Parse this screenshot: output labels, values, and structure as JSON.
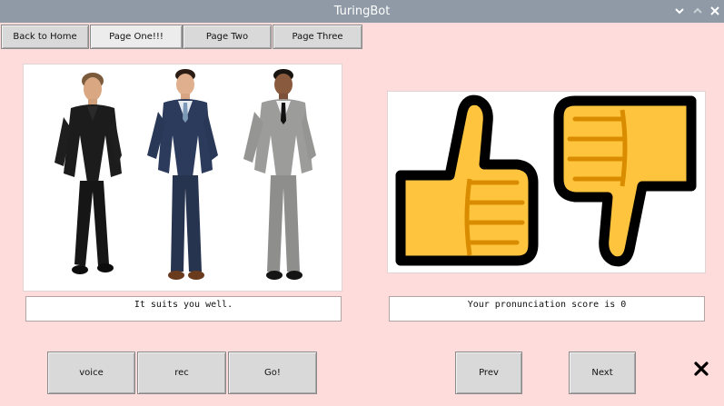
{
  "window": {
    "title": "TuringBot"
  },
  "nav": {
    "back_home": "Back to Home",
    "page_one": "Page One!!!",
    "page_two": "Page Two",
    "page_three": "Page Three"
  },
  "left_panel": {
    "image": "suits-photo",
    "caption": "It suits you well."
  },
  "right_panel": {
    "image": "thumbs-up-down-icons",
    "score_text": "Your pronunciation score is 0"
  },
  "controls": {
    "voice": "voice",
    "rec": "rec",
    "go": "Go!",
    "prev": "Prev",
    "next": "Next"
  },
  "icons": {
    "close": "close-x-icon",
    "minimize": "chevron-down-icon",
    "maximize": "chevron-up-icon",
    "window_close": "window-close-icon"
  },
  "colors": {
    "background": "#ffdcdc",
    "titlebar": "#8f9aa6",
    "thumb_fill": "#ffc43d",
    "thumb_outline": "#000000"
  }
}
